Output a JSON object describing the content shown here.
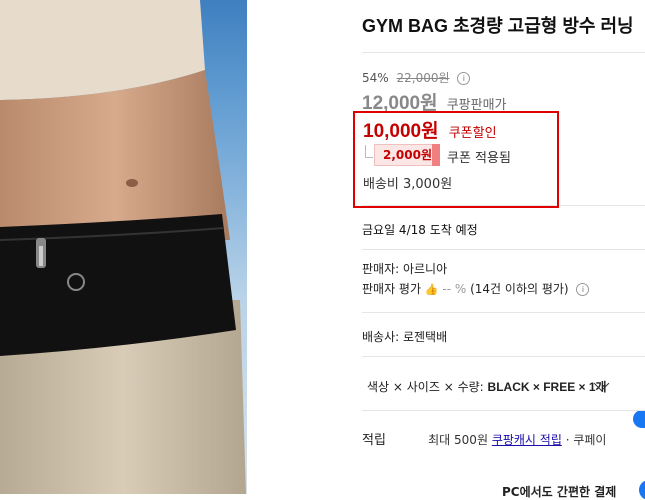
{
  "product": {
    "title": "GYM BAG 초경량 고급형 방수 러닝",
    "discount_rate": "54%",
    "original_price": "22,000원",
    "sale_price": "12,000원",
    "sale_label": "쿠팡판매가",
    "coupon_price": "10,000원",
    "coupon_label": "쿠폰할인",
    "coupon_amount": "2,000원",
    "coupon_applied": "쿠폰 적용됨",
    "shipping_fee": "배송비 3,000원",
    "delivery": "금요일 4/18 도착 예정"
  },
  "seller": {
    "name": "판매자: 아르니아",
    "rating_label": "판매자 평가",
    "rating_value": "-- %",
    "rating_count": "(14건 이하의 평가)"
  },
  "carrier": "배송사: 로젠택배",
  "options": {
    "label": "색상 × 사이즈 × 수량:",
    "value": "BLACK × FREE × 1개"
  },
  "points": {
    "label": "적립",
    "prefix": "최대 500원",
    "link": "쿠팡캐시 적립",
    "suffix": "· 쿠페이"
  },
  "pc_pay": "PC에서도 간편한 결제",
  "colors": {
    "coupon_red": "#c40000",
    "highlight_border": "#e00000",
    "link_blue": "#1a0dab",
    "accent_blue": "#1877f2"
  },
  "icons": [
    "info-icon",
    "thumbs-up-icon",
    "info-icon",
    "chevron-down-icon"
  ]
}
